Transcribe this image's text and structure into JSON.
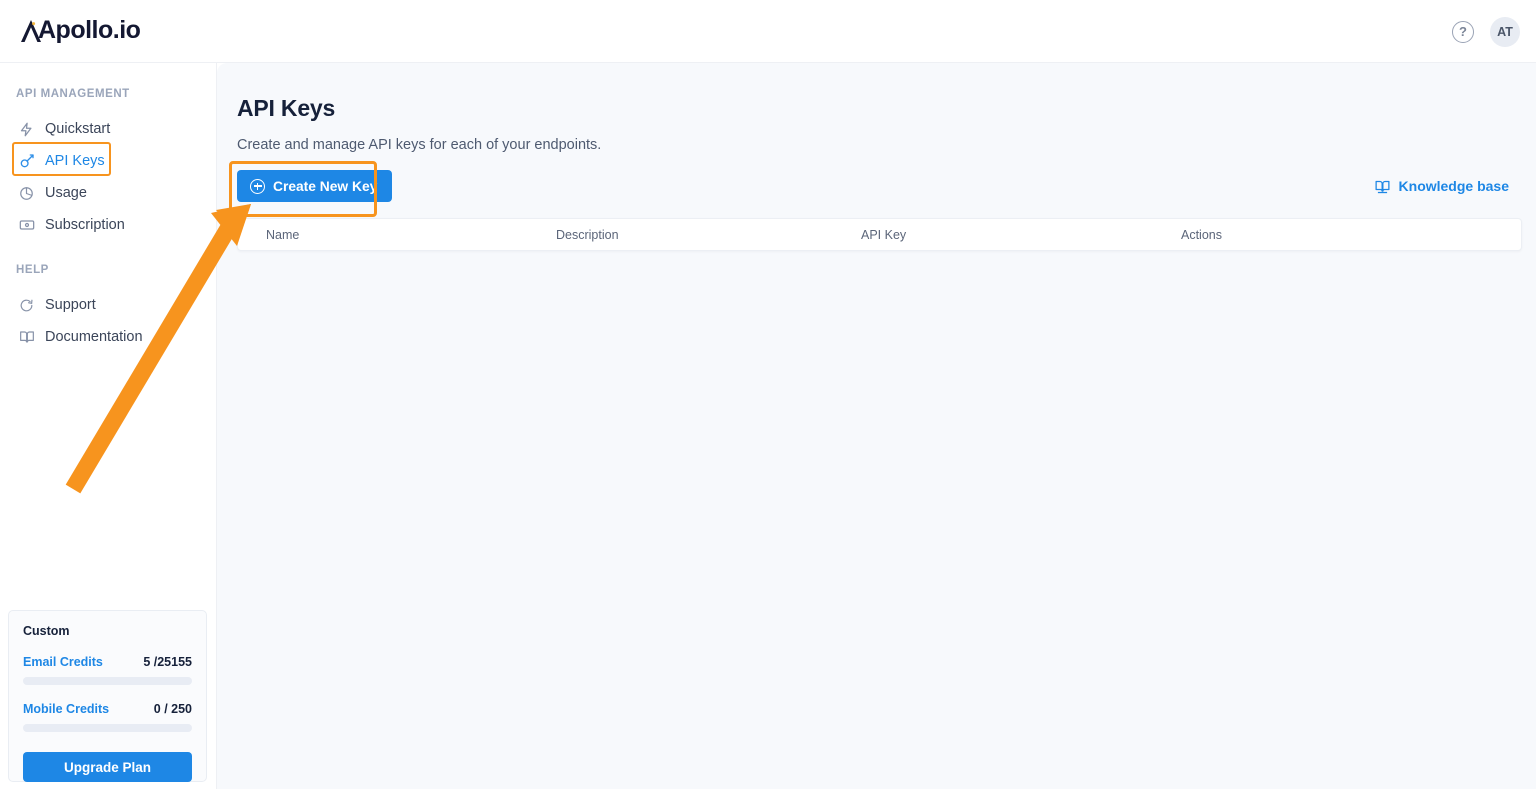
{
  "brand": {
    "name": "Apollo.io"
  },
  "topbar": {
    "help_icon": "question-mark-icon",
    "avatar_initials": "AT"
  },
  "sidebar": {
    "sections": [
      {
        "label": "API MANAGEMENT",
        "items": [
          {
            "label": "Quickstart",
            "icon": "lightning-bolt-icon",
            "active": false
          },
          {
            "label": "API Keys",
            "icon": "key-icon",
            "active": true,
            "highlighted": true
          },
          {
            "label": "Usage",
            "icon": "pie-chart-icon",
            "active": false
          },
          {
            "label": "Subscription",
            "icon": "credit-card-icon",
            "active": false
          }
        ]
      },
      {
        "label": "HELP",
        "items": [
          {
            "label": "Support",
            "icon": "lifebuoy-icon",
            "active": false
          },
          {
            "label": "Documentation",
            "icon": "book-icon",
            "active": false
          }
        ]
      }
    ],
    "credits": {
      "plan_name": "Custom",
      "rows": [
        {
          "label": "Email Credits",
          "value": "5 /25155",
          "percent": 0
        },
        {
          "label": "Mobile Credits",
          "value": "0 / 250",
          "percent": 0
        }
      ],
      "upgrade_label": "Upgrade Plan"
    }
  },
  "main": {
    "title": "API Keys",
    "subtitle": "Create and manage API keys for each of your endpoints.",
    "create_button": "Create New Key",
    "knowledge_base_link": "Knowledge base",
    "table": {
      "columns": [
        "Name",
        "Description",
        "API Key",
        "Actions"
      ],
      "rows": []
    }
  },
  "annotation": {
    "arrow_color": "#f7941e",
    "highlight_color": "#f7941e",
    "points_to": "Create New Key"
  },
  "colors": {
    "accent_blue": "#1e87e5",
    "annotation_orange": "#f7941e",
    "content_bg": "#f7f9fc",
    "text_dark": "#16213a"
  }
}
